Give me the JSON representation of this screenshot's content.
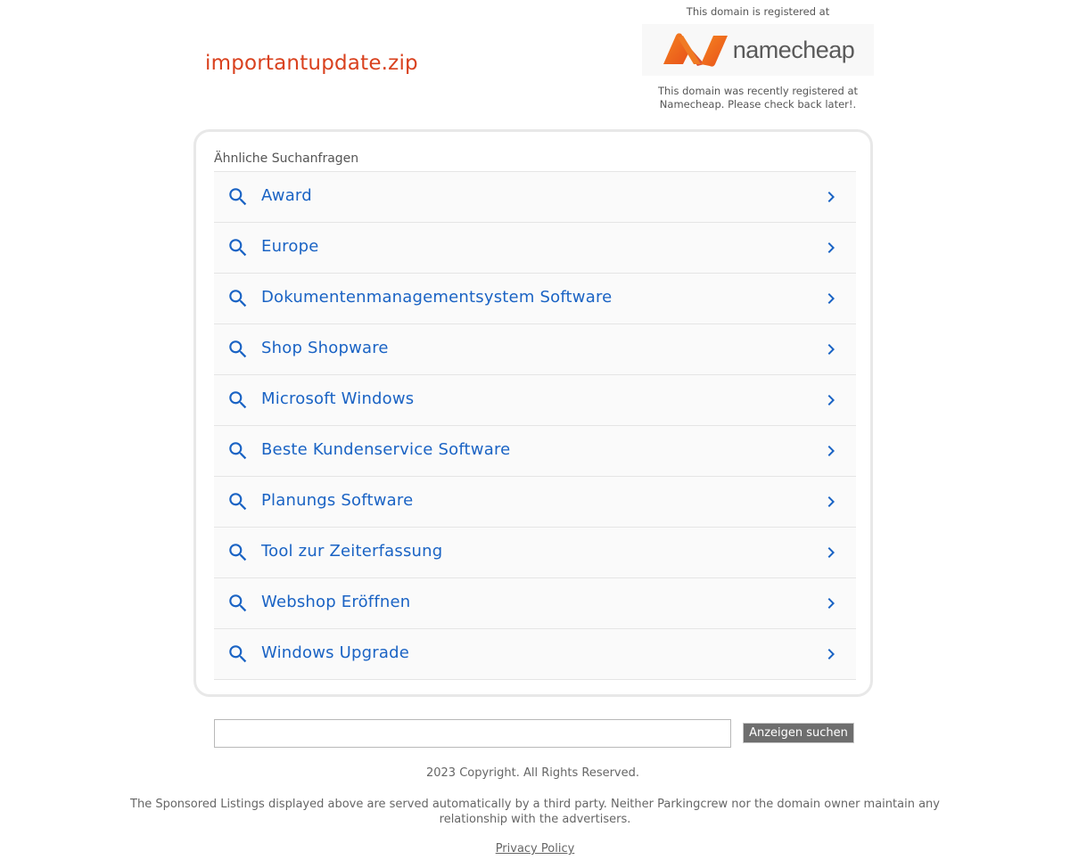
{
  "domain": "importantupdate.zip",
  "registrar": {
    "top_note": "This domain is registered at",
    "logo_text": "namecheap",
    "note_line1": "This domain was recently registered at",
    "note_line2": "Namecheap. Please check back later!."
  },
  "related": {
    "heading": "Ähnliche Suchanfragen",
    "items": [
      {
        "label": "Award"
      },
      {
        "label": "Europe"
      },
      {
        "label": "Dokumentenmanagementsystem Software"
      },
      {
        "label": "Shop Shopware"
      },
      {
        "label": "Microsoft Windows"
      },
      {
        "label": "Beste Kundenservice Software"
      },
      {
        "label": "Planungs Software"
      },
      {
        "label": "Tool zur Zeiterfassung"
      },
      {
        "label": "Webshop Eröffnen"
      },
      {
        "label": "Windows Upgrade"
      }
    ],
    "item_icon": "search-icon",
    "item_arrow_icon": "chevron-right-icon"
  },
  "search": {
    "value": "",
    "button_label": "Anzeigen suchen"
  },
  "footer": {
    "copyright": "2023 Copyright. All Rights Reserved.",
    "disclaimer": "The Sponsored Listings displayed above are served automatically by a third party. Neither Parkingcrew nor the domain owner maintain any relationship with the advertisers.",
    "privacy_label": "Privacy Policy"
  },
  "colors": {
    "domain_title": "#d9411e",
    "link": "#1a63c4",
    "logo_orange": "#ef6a21",
    "button_bg": "#6e6e6e"
  }
}
